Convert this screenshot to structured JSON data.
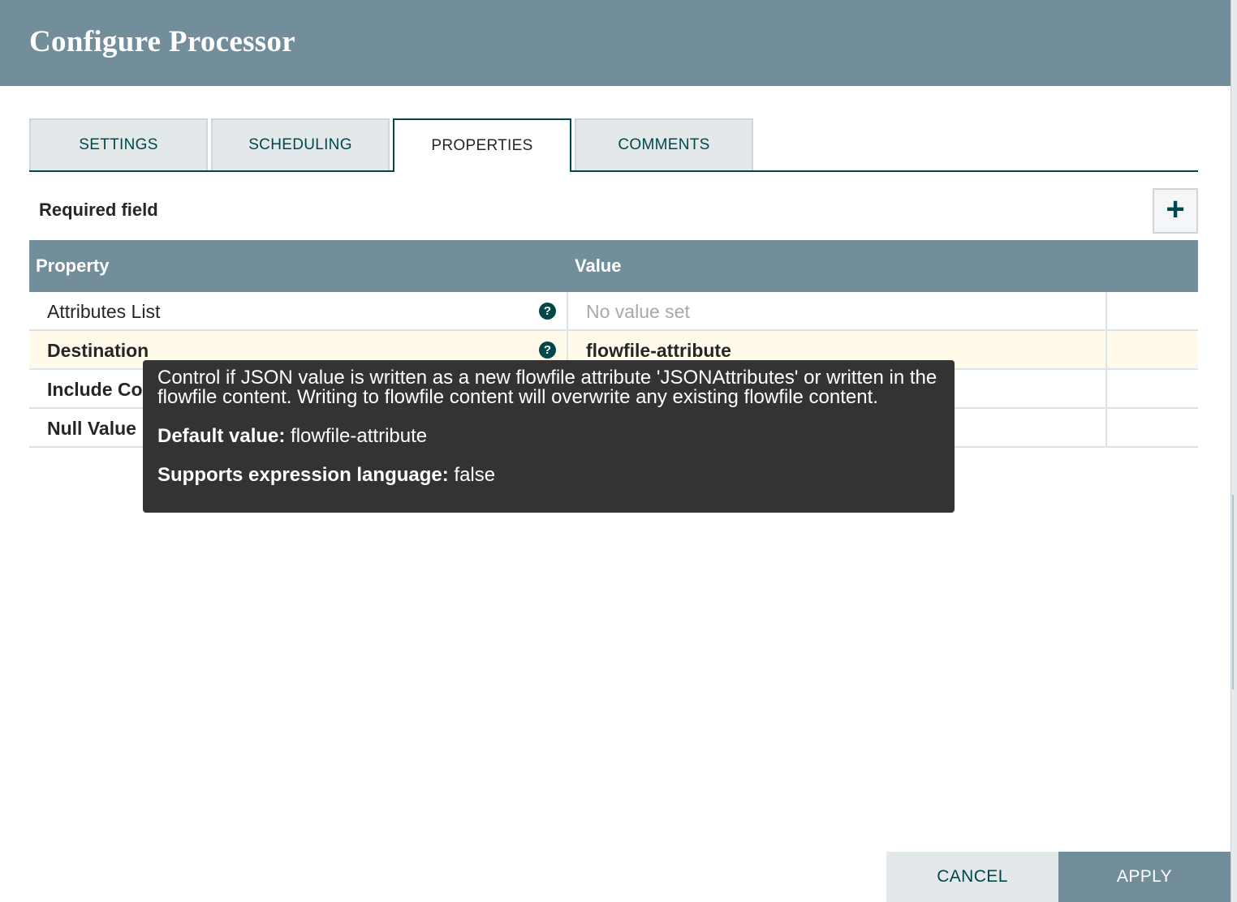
{
  "dialog": {
    "title": "Configure Processor"
  },
  "tabs": [
    {
      "label": "SETTINGS",
      "active": false
    },
    {
      "label": "SCHEDULING",
      "active": false
    },
    {
      "label": "PROPERTIES",
      "active": true
    },
    {
      "label": "COMMENTS",
      "active": false
    }
  ],
  "required_label": "Required field",
  "add_button": {
    "glyph": "+",
    "icon": "plus-icon"
  },
  "table": {
    "headers": {
      "property": "Property",
      "value": "Value"
    },
    "rows": [
      {
        "property": "Attributes List",
        "value": "No value set",
        "required": false,
        "selected": false
      },
      {
        "property": "Destination",
        "value": "flowfile-attribute",
        "required": true,
        "selected": true
      },
      {
        "property": "Include Core Attributes",
        "value": "true",
        "required": true,
        "selected": false
      },
      {
        "property": "Null Value",
        "value": "false",
        "required": true,
        "selected": false
      }
    ],
    "help_glyph": "?"
  },
  "tooltip": {
    "description": "Control if JSON value is written as a new flowfile attribute 'JSONAttributes' or written in the flowfile content. Writing to flowfile content will overwrite any existing flowfile content.",
    "default_label": "Default value:",
    "default_value": "flowfile-attribute",
    "el_label": "Supports expression language:",
    "el_value": "false"
  },
  "footer": {
    "cancel": "CANCEL",
    "apply": "APPLY"
  },
  "colors": {
    "header": "#728e9b",
    "accent": "#004849",
    "selected_row": "#fffaea",
    "tooltip_bg": "#333333"
  }
}
